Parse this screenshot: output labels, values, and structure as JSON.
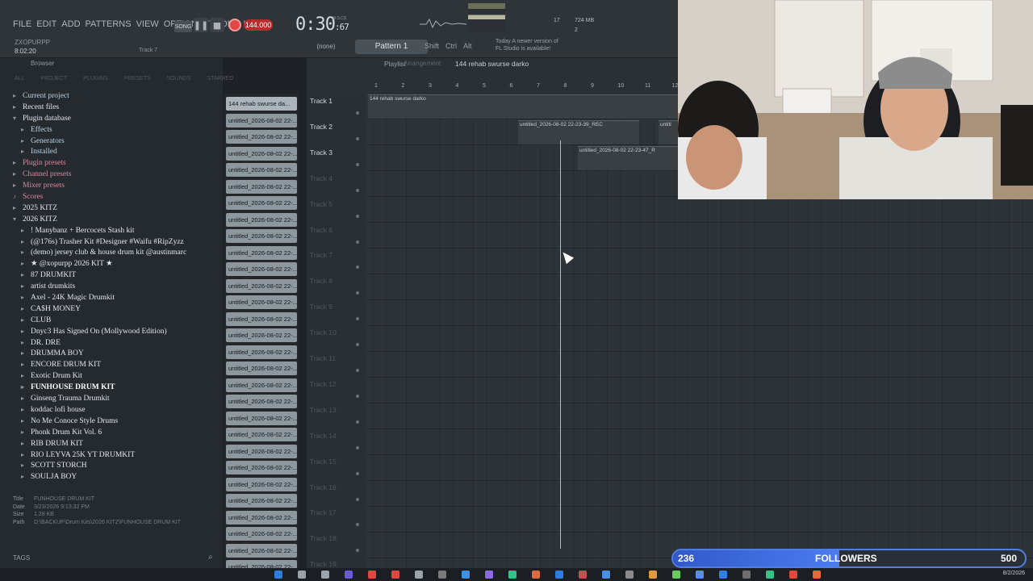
{
  "menu": [
    "FILE",
    "EDIT",
    "ADD",
    "PATTERNS",
    "VIEW",
    "OPTIONS",
    "TOOLS",
    "HELP"
  ],
  "transport": {
    "song_mode": "SONG",
    "tempo": "144.000",
    "time": "0:30",
    "time_ms": ":67",
    "time_label": "M:S:CS"
  },
  "hint": {
    "user": "ZXOPURPP",
    "time": "8:02:20",
    "track": "Track 7"
  },
  "snap": "(none)",
  "pattern": "Pattern 1",
  "modifiers": [
    "Shift",
    "Ctrl",
    "Alt"
  ],
  "update_note": [
    "Today  A newer version of",
    "FL Studio is available!"
  ],
  "cpu": {
    "value": "17",
    "mem": "724 MB",
    "poly": "2"
  },
  "browser": {
    "title": "Browser",
    "tabs": [
      "ALL",
      "PROJECT",
      "PLUGINS",
      "PRESETS",
      "SOUNDS",
      "STARRED"
    ],
    "tree": [
      {
        "label": "Current project",
        "lvl": 0,
        "color": "blue",
        "icon": "▸"
      },
      {
        "label": "Recent files",
        "lvl": 0,
        "color": "white",
        "icon": "▸"
      },
      {
        "label": "Plugin database",
        "lvl": 0,
        "color": "white",
        "icon": "▾"
      },
      {
        "label": "Effects",
        "lvl": 1,
        "color": "blue",
        "icon": "▸"
      },
      {
        "label": "Generators",
        "lvl": 1,
        "color": "blue",
        "icon": "▸"
      },
      {
        "label": "Installed",
        "lvl": 1,
        "color": "blue",
        "icon": "▸"
      },
      {
        "label": "Plugin presets",
        "lvl": 0,
        "color": "pink",
        "icon": "▸"
      },
      {
        "label": "Channel presets",
        "lvl": 0,
        "color": "pink",
        "icon": "▸"
      },
      {
        "label": "Mixer presets",
        "lvl": 0,
        "color": "pink",
        "icon": "▸"
      },
      {
        "label": "Scores",
        "lvl": 0,
        "color": "pink",
        "icon": "♪"
      },
      {
        "label": "2025 KITZ",
        "lvl": 0,
        "color": "white",
        "icon": "▸"
      },
      {
        "label": "2026 KITZ",
        "lvl": 0,
        "color": "white",
        "icon": "▾"
      },
      {
        "label": "! Manybanz + Bercocets Stash kit",
        "lvl": 1,
        "color": "white",
        "icon": "▸"
      },
      {
        "label": "(@176s) Trasher Kit #Designer #Waifu #RipZyzz",
        "lvl": 1,
        "color": "white",
        "icon": "▸"
      },
      {
        "label": "(demo) jersey club & house drum kit @austinmarc",
        "lvl": 1,
        "color": "white",
        "icon": "▸"
      },
      {
        "label": "★ @xopurpp 2026 KIT ★",
        "lvl": 1,
        "color": "white",
        "icon": "▸"
      },
      {
        "label": "87 DRUMKIT",
        "lvl": 1,
        "color": "white",
        "icon": "▸"
      },
      {
        "label": "artist drumkits",
        "lvl": 1,
        "color": "white",
        "icon": "▸"
      },
      {
        "label": "Axel - 24K Magic Drumkit",
        "lvl": 1,
        "color": "white",
        "icon": "▸"
      },
      {
        "label": "CA$H MONEY",
        "lvl": 1,
        "color": "white",
        "icon": "▸"
      },
      {
        "label": "CLUB",
        "lvl": 1,
        "color": "white",
        "icon": "▸"
      },
      {
        "label": "Dnyc3 Has Signed On (Mollywood Edition)",
        "lvl": 1,
        "color": "white",
        "icon": "▸"
      },
      {
        "label": "DR. DRE",
        "lvl": 1,
        "color": "white",
        "icon": "▸"
      },
      {
        "label": "DRUMMA BOY",
        "lvl": 1,
        "color": "white",
        "icon": "▸"
      },
      {
        "label": "ENCORE DRUM KIT",
        "lvl": 1,
        "color": "white",
        "icon": "▸"
      },
      {
        "label": "Exotic Drum Kit",
        "lvl": 1,
        "color": "white",
        "icon": "▸"
      },
      {
        "label": "FUNHOUSE DRUM KIT",
        "lvl": 1,
        "color": "sel",
        "icon": "▸"
      },
      {
        "label": "Ginseng Trauma Drumkit",
        "lvl": 1,
        "color": "white",
        "icon": "▸"
      },
      {
        "label": "koddac lofi house",
        "lvl": 1,
        "color": "white",
        "icon": "▸"
      },
      {
        "label": "No Me Conoce Style Drums",
        "lvl": 1,
        "color": "white",
        "icon": "▸"
      },
      {
        "label": "Phonk Drum Kit Vol. 6",
        "lvl": 1,
        "color": "white",
        "icon": "▸"
      },
      {
        "label": "RIB DRUM KIT",
        "lvl": 1,
        "color": "white",
        "icon": "▸"
      },
      {
        "label": "RIO LEYVA 25K YT DRUMKIT",
        "lvl": 1,
        "color": "white",
        "icon": "▸"
      },
      {
        "label": "SCOTT STORCH",
        "lvl": 1,
        "color": "white",
        "icon": "▸"
      },
      {
        "label": "SOULJA BOY",
        "lvl": 1,
        "color": "white",
        "icon": "▸"
      }
    ],
    "info": {
      "title_k": "Title",
      "title_v": "FUNHOUSE DRUM KIT",
      "date_k": "Date",
      "date_v": "3/23/2026 9:13:32 PM",
      "size_k": "Size",
      "size_v": "1.28 KB",
      "path_k": "Path",
      "path_v": "D:\\BACKUP\\Drum Kits\\2026 KITZ\\FUNHOUSE DRUM KIT"
    },
    "tags_label": "TAGS"
  },
  "patterns": [
    "144 rehab swurse da...",
    "untitled_2026-08-02 22-...",
    "untitled_2026-08-02 22-...",
    "untitled_2026-08-02 22-...",
    "untitled_2026-08-02 22-...",
    "untitled_2026-08-02 22-...",
    "untitled_2026-08-02 22-...",
    "untitled_2026-08-02 22-...",
    "untitled_2026-08-02 22-...",
    "untitled_2026-08-02 22-...",
    "untitled_2026-08-02 22-...",
    "untitled_2026-08-02 22-...",
    "untitled_2026-08-02 22-...",
    "untitled_2026-08-02 22-...",
    "untitled_2026-08-02 22-...",
    "untitled_2026-08-02 22-...",
    "untitled_2026-08-02 22-...",
    "untitled_2026-08-02 22-...",
    "untitled_2026-08-02 22-...",
    "untitled_2026-08-02 22-...",
    "untitled_2026-08-02 22-...",
    "untitled_2026-08-02 22-...",
    "untitled_2026-08-02 22-...",
    "untitled_2026-08-02 22-...",
    "untitled_2026-08-02 22-...",
    "untitled_2026-08-02 22-...",
    "untitled_2026-08-02 22-...",
    "untitled_2026-08-02 22-...",
    "untitled_2026-08-02 22-..."
  ],
  "playlist": {
    "title": "Playlist",
    "subtitle": "Arrangement",
    "pattern_name": "144 rehab swurse darko",
    "ruler": [
      "1",
      "2",
      "3",
      "4",
      "5",
      "6",
      "7",
      "8",
      "9",
      "10",
      "11",
      "12"
    ],
    "tracks": [
      "Track 1",
      "Track 2",
      "Track 3",
      "Track 4",
      "Track 5",
      "Track 6",
      "Track 7",
      "Track 8",
      "Track 9",
      "Track 10",
      "Track 11",
      "Track 12",
      "Track 13",
      "Track 14",
      "Track 15",
      "Track 16",
      "Track 17",
      "Track 18",
      "Track 19"
    ],
    "clips": [
      {
        "title": "144 rehab swurse darko"
      },
      {
        "title": "untitled_2026-08-02 22-23-39_REC"
      },
      {
        "title": "untitl"
      },
      {
        "title": "untitled_2026-08-02 22-23-47_R"
      }
    ]
  },
  "followers": {
    "label": "FOLLOWERS",
    "current": "236",
    "goal": "500",
    "progress": 0.472
  },
  "taskbar_date": "8/2/2026"
}
